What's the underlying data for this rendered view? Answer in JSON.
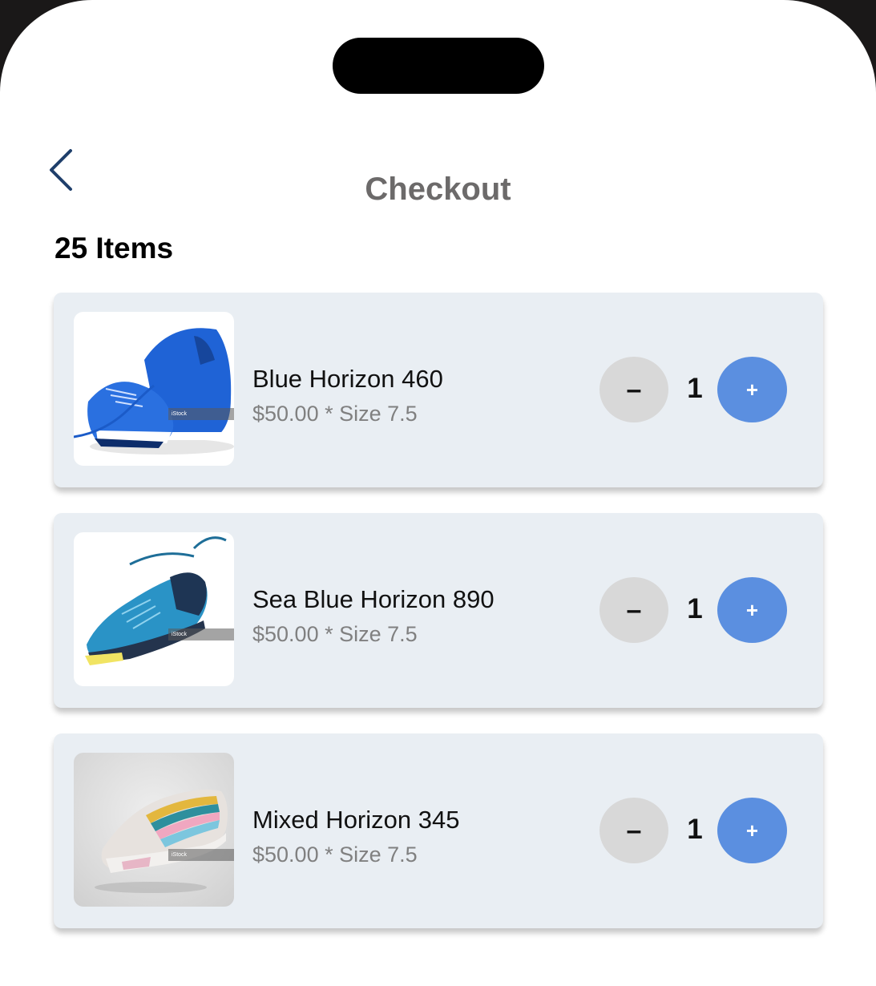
{
  "header": {
    "title": "Checkout",
    "back_icon": "chevron-left-icon"
  },
  "cart": {
    "count_label": "25 Items",
    "items": [
      {
        "name": "Blue Horizon 460",
        "meta": "$50.00 * Size 7.5",
        "quantity": "1",
        "minus_label": "–",
        "plus_label": "+",
        "image": "blue running shoe",
        "watermark": "iStock"
      },
      {
        "name": "Sea Blue Horizon 890",
        "meta": "$50.00 * Size 7.5",
        "quantity": "1",
        "minus_label": "–",
        "plus_label": "+",
        "image": "teal trail shoe",
        "watermark": "iStock"
      },
      {
        "name": "Mixed Horizon 345",
        "meta": "$50.00 * Size 7.5",
        "quantity": "1",
        "minus_label": "–",
        "plus_label": "+",
        "image": "multicolor sneaker",
        "watermark": "iStock"
      }
    ]
  },
  "colors": {
    "card_bg": "#e9eef3",
    "minus_bg": "#d8d8d8",
    "plus_bg": "#5b8fe0",
    "title_color": "#6c6a6a",
    "back_icon_color": "#1f3f6b"
  }
}
